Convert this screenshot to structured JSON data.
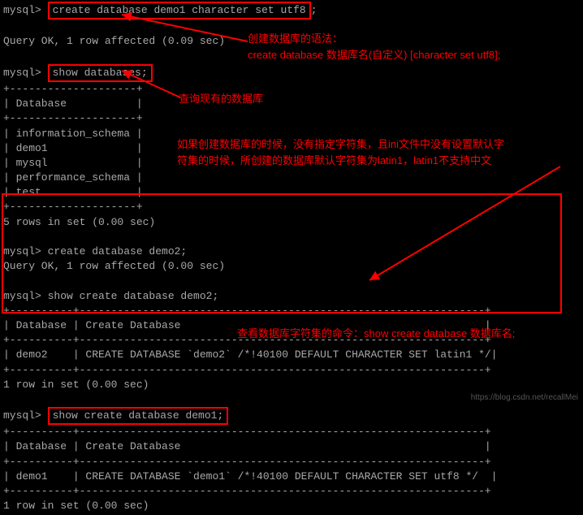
{
  "cmd1_prompt": "mysql>",
  "cmd1": "create database demo1 character set utf8",
  "cmd1_sep": ";",
  "result1_line1": "Query OK, 1 row affected (0.09 sec)",
  "ann1_line1": "创建数据库的语法：",
  "ann1_line2": "create database 数据库名(自定义) [character set utf8];",
  "cmd2_prompt": "mysql>",
  "cmd2": "show databases;",
  "ann2": "查询现有的数据库",
  "tb_head_border": "+--------------------+",
  "tb_head": "| Database           |",
  "tb_row1": "| information_schema |",
  "tb_row2": "| demo1              |",
  "tb_row3": "| mysql              |",
  "tb_row4": "| performance_schema |",
  "tb_row5": "| test               |",
  "result2": "5 rows in set (0.00 sec)",
  "ann3_line1": "如果创建数据库的时候，没有指定字符集，且ini文件中没有设置默认字",
  "ann3_line2": "符集的时候，所创建的数据库默认字符集为latin1，latin1不支持中文",
  "cmd3": "mysql> create database demo2;",
  "result3": "Query OK, 1 row affected (0.00 sec)",
  "cmd4": "mysql> show create database demo2;",
  "tb2_border": "+----------+----------------------------------------------------------------+",
  "tb2_head": "| Database | Create Database                                                |",
  "tb2_row": "| demo2    | CREATE DATABASE `demo2` /*!40100 DEFAULT CHARACTER SET latin1 */|",
  "result4": "1 row in set (0.00 sec)",
  "cmd5_prompt": "mysql>",
  "cmd5": "show create database demo1;",
  "ann4": "查看数据库字符集的命令：show create database 数据库名;",
  "tb3_border": "+----------+----------------------------------------------------------------+",
  "tb3_head": "| Database | Create Database                                                |",
  "tb3_row": "| demo1    | CREATE DATABASE `demo1` /*!40100 DEFAULT CHARACTER SET utf8 */  |",
  "result5": "1 row in set (0.00 sec)",
  "watermark": "https://blog.csdn.net/recallMei"
}
